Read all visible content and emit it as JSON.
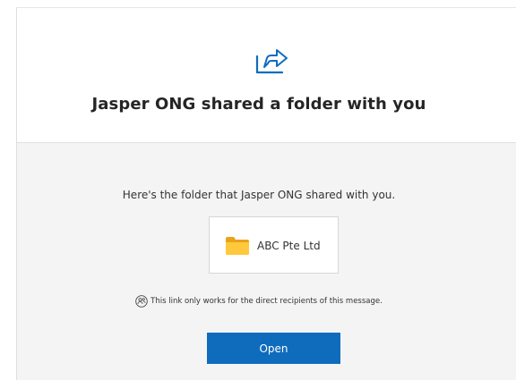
{
  "header": {
    "icon": "share-icon",
    "title": "Jasper ONG shared a folder with you"
  },
  "body": {
    "message": "Here's the folder that Jasper ONG shared with you.",
    "folder": {
      "icon": "folder-icon",
      "name": "ABC Pte Ltd"
    },
    "notice": {
      "icon": "people-icon",
      "text": "This link only works for the direct recipients of this message."
    },
    "open_button_label": "Open"
  },
  "colors": {
    "accent": "#0f6cbd",
    "folder_yellow": "#ffc83d",
    "body_background": "#f4f4f4"
  }
}
